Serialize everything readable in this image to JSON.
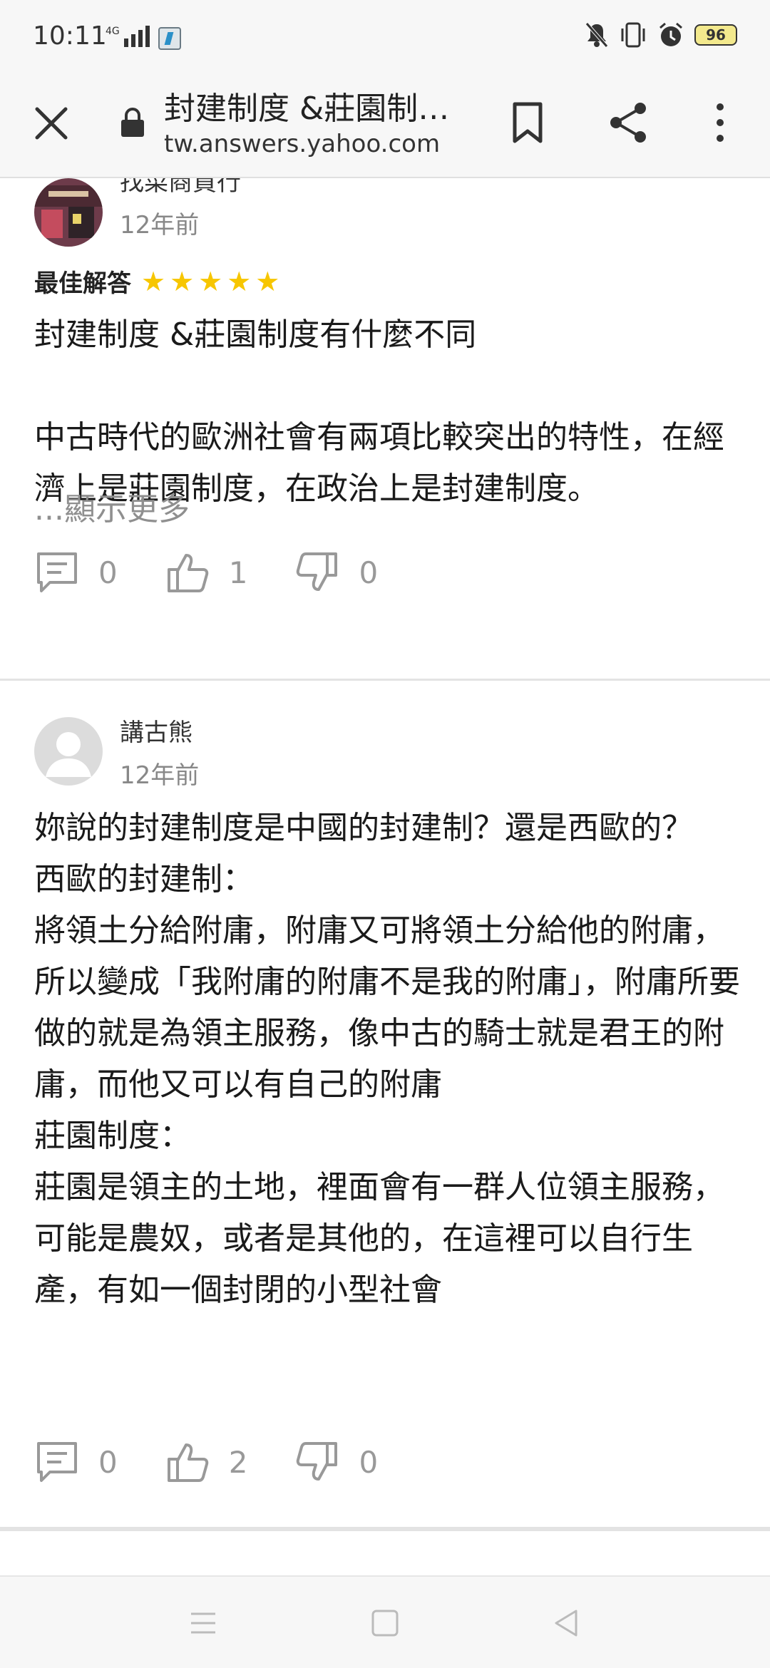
{
  "status_bar": {
    "time": "10:11",
    "network": "4G",
    "battery": "96"
  },
  "browser": {
    "page_title": "封建制度 &莊園制…",
    "url": "tw.answers.yahoo.com"
  },
  "answers": [
    {
      "author": "找菜商買行",
      "time": "12年前",
      "best_label": "最佳解答",
      "stars": "★★★★★",
      "rating": 5,
      "text": "封建制度 &莊園制度有什麼不同\n\n中古時代的歐洲社會有兩項比較突出的特性，在經濟上是莊園制度，在政治上是封建制度。",
      "show_more": "...顯示更多",
      "comments": "0",
      "likes": "1",
      "dislikes": "0"
    },
    {
      "author": "講古熊",
      "time": "12年前",
      "text": "妳說的封建制度是中國的封建制？還是西歐的？\n西歐的封建制：\n將領土分給附庸，附庸又可將領土分給他的附庸，所以變成「我附庸的附庸不是我的附庸」，附庸所要做的就是為領主服務，像中古的騎士就是君王的附庸，而他又可以有自己的附庸\n莊園制度：\n莊園是領主的土地，裡面會有一群人位領主服務，可能是農奴，或者是其他的，在這裡可以自行生產，有如一個封閉的小型社會",
      "comments": "0",
      "likes": "2",
      "dislikes": "0"
    }
  ],
  "colors": {
    "star": "#f7c600",
    "muted": "#8f8f8f",
    "divider": "#e3e3e3"
  }
}
